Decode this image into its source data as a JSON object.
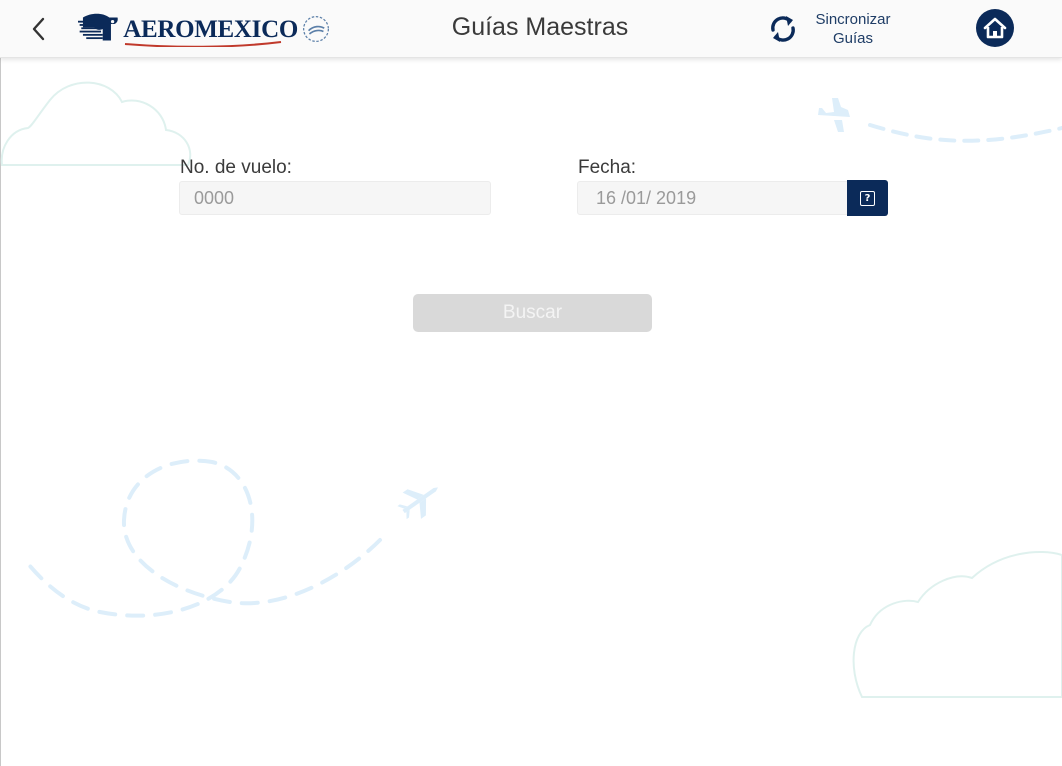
{
  "header": {
    "back_icon": "chevron-left-icon",
    "logo_text": "AEROMEXICO",
    "title": "Guías Maestras",
    "sync_label_line1": "Sincronizar",
    "sync_label_line2": "Guías",
    "sync_icon": "sync-icon",
    "home_icon": "home-icon"
  },
  "form": {
    "flight": {
      "label": "No. de vuelo:",
      "placeholder": "0000",
      "value": ""
    },
    "date": {
      "label": "Fecha:",
      "value": "16 /01/ 2019",
      "button_icon": "calendar-icon",
      "button_glyph": "?"
    },
    "search_label": "Buscar"
  },
  "colors": {
    "brand_navy": "#0b2a59",
    "disabled_button": "#d9d9d9",
    "input_bg": "#f6f6f6",
    "deco_blue": "#ddeefa",
    "deco_green": "#dff1ee"
  }
}
